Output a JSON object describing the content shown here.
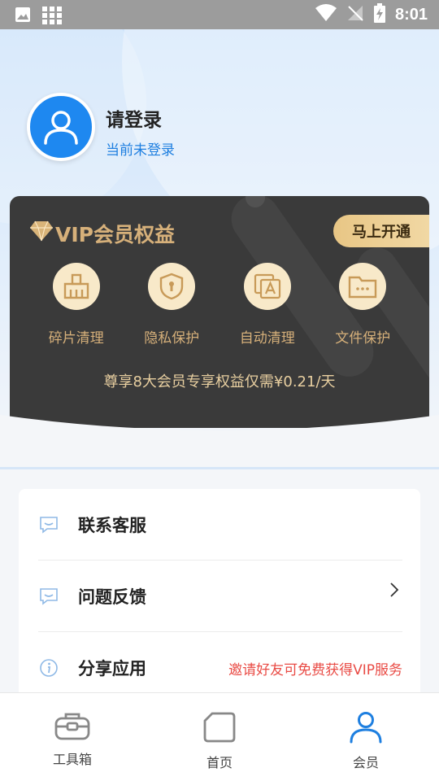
{
  "status_bar": {
    "time": "8:01"
  },
  "profile": {
    "title": "请登录",
    "subtitle": "当前未登录"
  },
  "vip": {
    "title": "VIP会员权益",
    "open_button": "马上开通",
    "features": [
      {
        "label": "碎片清理",
        "icon": "broom-icon"
      },
      {
        "label": "隐私保护",
        "icon": "shield-lock-icon"
      },
      {
        "label": "自动清理",
        "icon": "auto-clean-icon"
      },
      {
        "label": "文件保护",
        "icon": "folder-password-icon"
      }
    ],
    "description": "尊享8大会员专享权益仅需¥0.21/天"
  },
  "menu": {
    "items": [
      {
        "label": "联系客服",
        "icon": "chat-smile-icon",
        "right": ""
      },
      {
        "label": "问题反馈",
        "icon": "chat-smile-icon",
        "right": ""
      },
      {
        "label": "分享应用",
        "icon": "info-icon",
        "right": "邀请好友可免费获得VIP服务"
      }
    ]
  },
  "tabbar": {
    "tabs": [
      {
        "label": "工具箱",
        "icon": "toolbox-icon"
      },
      {
        "label": "首页",
        "icon": "home-hexagon-icon"
      },
      {
        "label": "会员",
        "icon": "user-icon"
      }
    ],
    "active_index": 2
  },
  "colors": {
    "accent_blue": "#1e88f0",
    "gold": "#d6b07a",
    "card_dark": "#3a3a3a",
    "promo_red": "#e94b45"
  }
}
